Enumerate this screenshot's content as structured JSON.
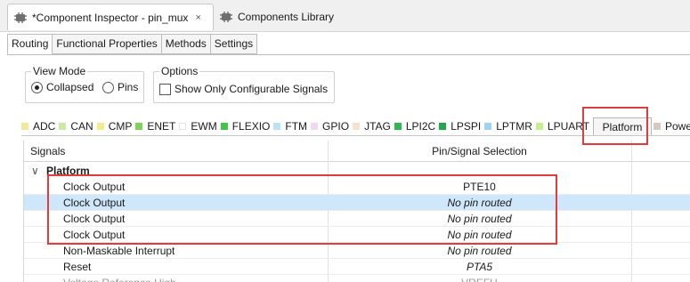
{
  "editor_tabs": [
    {
      "label": "*Component Inspector - pin_mux",
      "icon": "chip-icon",
      "active": true,
      "close": "×"
    },
    {
      "label": "Components Library",
      "icon": "chip-icon",
      "active": false
    }
  ],
  "subtabs": [
    "Routing",
    "Functional Properties",
    "Methods",
    "Settings"
  ],
  "view_mode": {
    "title": "View Mode",
    "options": [
      "Collapsed",
      "Pins"
    ],
    "selected": "Collapsed"
  },
  "options": {
    "title": "Options",
    "checkbox_label": "Show Only Configurable Signals",
    "checked": false
  },
  "peripheral_tabs": [
    {
      "label": "ADC",
      "color": "#f4e99a"
    },
    {
      "label": "CAN",
      "color": "#cfe8a8"
    },
    {
      "label": "CMP",
      "color": "#f2ec8c"
    },
    {
      "label": "ENET",
      "color": "#7fd35c"
    },
    {
      "label": "EWM",
      "color": "#ffffff"
    },
    {
      "label": "FLEXIO",
      "color": "#47c447"
    },
    {
      "label": "FTM",
      "color": "#b9e1f7"
    },
    {
      "label": "GPIO",
      "color": "#f0d9f0"
    },
    {
      "label": "JTAG",
      "color": "#f7e1cf"
    },
    {
      "label": "LPI2C",
      "color": "#2fb84f"
    },
    {
      "label": "LPSPI",
      "color": "#21a84c"
    },
    {
      "label": "LPTMR",
      "color": "#9fd4f0"
    },
    {
      "label": "LPUART",
      "color": "#c6ee8a"
    },
    {
      "label": "Platform",
      "color": "#e8d3c2"
    },
    {
      "label": "Powe",
      "color": "#d9c8bd"
    }
  ],
  "table": {
    "headers": {
      "signals": "Signals",
      "pin": "Pin/Signal Selection"
    },
    "group": "Platform",
    "rows": [
      {
        "signal": "Clock Output",
        "pin": "PTE10",
        "italic": false,
        "selected": false
      },
      {
        "signal": "Clock Output",
        "pin": "No pin routed",
        "italic": true,
        "selected": true
      },
      {
        "signal": "Clock Output",
        "pin": "No pin routed",
        "italic": true,
        "selected": false
      },
      {
        "signal": "Clock Output",
        "pin": "No pin routed",
        "italic": true,
        "selected": false
      },
      {
        "signal": "Non-Maskable Interrupt",
        "pin": "No pin routed",
        "italic": true,
        "selected": false
      },
      {
        "signal": "Reset",
        "pin": "PTA5",
        "italic": true,
        "selected": false
      },
      {
        "signal": "Voltage Reference High",
        "pin": "VREFH",
        "italic": false,
        "selected": false
      }
    ]
  },
  "colors": {
    "highlight": "#e23b3b",
    "selection": "#cfe7fa"
  }
}
